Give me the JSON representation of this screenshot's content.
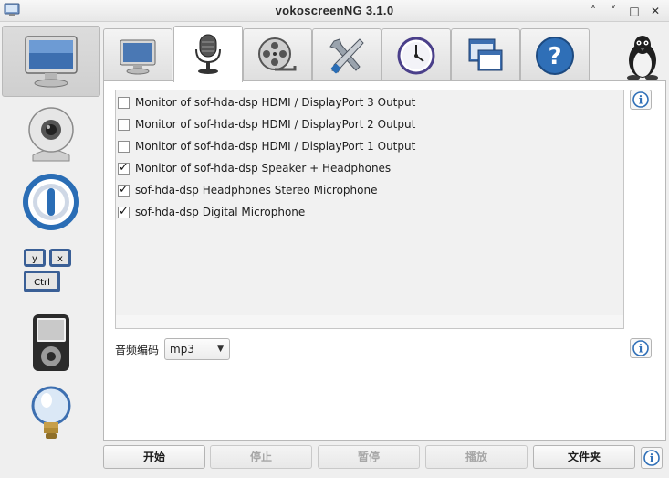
{
  "window": {
    "title": "vokoscreenNG 3.1.0",
    "minimize_glyph": "˄",
    "shade_glyph": "˅",
    "maximize_glyph": "□",
    "close_glyph": "✕"
  },
  "sidebar": {
    "items": [
      {
        "icon": "monitor-icon",
        "active": true
      },
      {
        "icon": "webcam-icon",
        "active": false
      },
      {
        "icon": "magnifier-icon",
        "active": false
      },
      {
        "icon": "keyboard-icon",
        "active": false
      },
      {
        "icon": "media-player-icon",
        "active": false
      },
      {
        "icon": "lightbulb-icon",
        "active": false
      }
    ],
    "keys": {
      "y": "y",
      "x": "x",
      "ctrl": "Ctrl"
    }
  },
  "tabs": [
    {
      "icon": "monitor-icon",
      "active": false
    },
    {
      "icon": "microphone-icon",
      "active": true
    },
    {
      "icon": "film-reel-icon",
      "active": false
    },
    {
      "icon": "tools-icon",
      "active": false
    },
    {
      "icon": "clock-icon",
      "active": false
    },
    {
      "icon": "windows-icon",
      "active": false
    },
    {
      "icon": "help-icon",
      "active": false
    }
  ],
  "help_glyph": "?",
  "info_glyph": "i",
  "audio": {
    "devices": [
      {
        "label": "Monitor of sof-hda-dsp HDMI / DisplayPort 3 Output",
        "checked": false
      },
      {
        "label": "Monitor of sof-hda-dsp HDMI / DisplayPort 2 Output",
        "checked": false
      },
      {
        "label": "Monitor of sof-hda-dsp HDMI / DisplayPort 1 Output",
        "checked": false
      },
      {
        "label": "Monitor of sof-hda-dsp Speaker + Headphones",
        "checked": true
      },
      {
        "label": "sof-hda-dsp Headphones Stereo Microphone",
        "checked": true
      },
      {
        "label": "sof-hda-dsp Digital Microphone",
        "checked": true
      }
    ],
    "codec_label": "音频编码",
    "codec_value": "mp3",
    "codec_arrow": "▼"
  },
  "buttons": {
    "start": "开始",
    "stop": "停止",
    "pause": "暂停",
    "play": "播放",
    "folder": "文件夹"
  },
  "colors": {
    "accent_blue": "#2a6db5",
    "info_blue": "#2f6fb7"
  }
}
